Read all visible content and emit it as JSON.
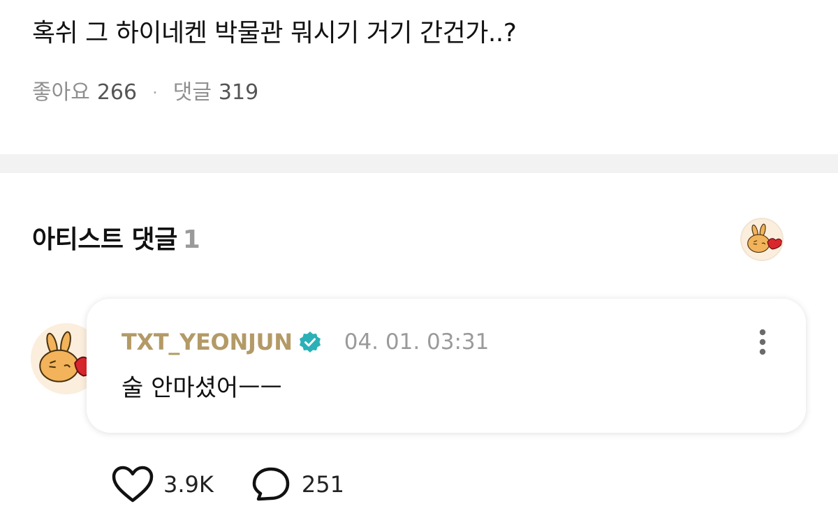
{
  "post": {
    "title": "혹쉬 그 하이네켄 박물관 뭐시기 거기 간건가..?",
    "likes_label": "좋아요",
    "likes_count": "266",
    "separator": "·",
    "comments_label": "댓글",
    "comments_count": "319"
  },
  "artist_comments": {
    "title": "아티스트 댓글",
    "count": "1"
  },
  "comment": {
    "author": "TXT_YEONJUN",
    "verified": true,
    "timestamp": "04. 01. 03:31",
    "text": "술 안마셨어ㅡㅡ",
    "likes": "3.9K",
    "replies": "251"
  },
  "colors": {
    "author": "#b39a66",
    "verified": "#2bb0b7",
    "muted": "#8f8f8f",
    "divider": "#f2f2f2",
    "avatar_bg": "#fbeedd"
  },
  "icons": {
    "verified": "verified-badge-icon",
    "more": "more-vertical-icon",
    "like": "heart-icon",
    "reply": "speech-bubble-icon",
    "avatar": "bunny-character-avatar"
  }
}
